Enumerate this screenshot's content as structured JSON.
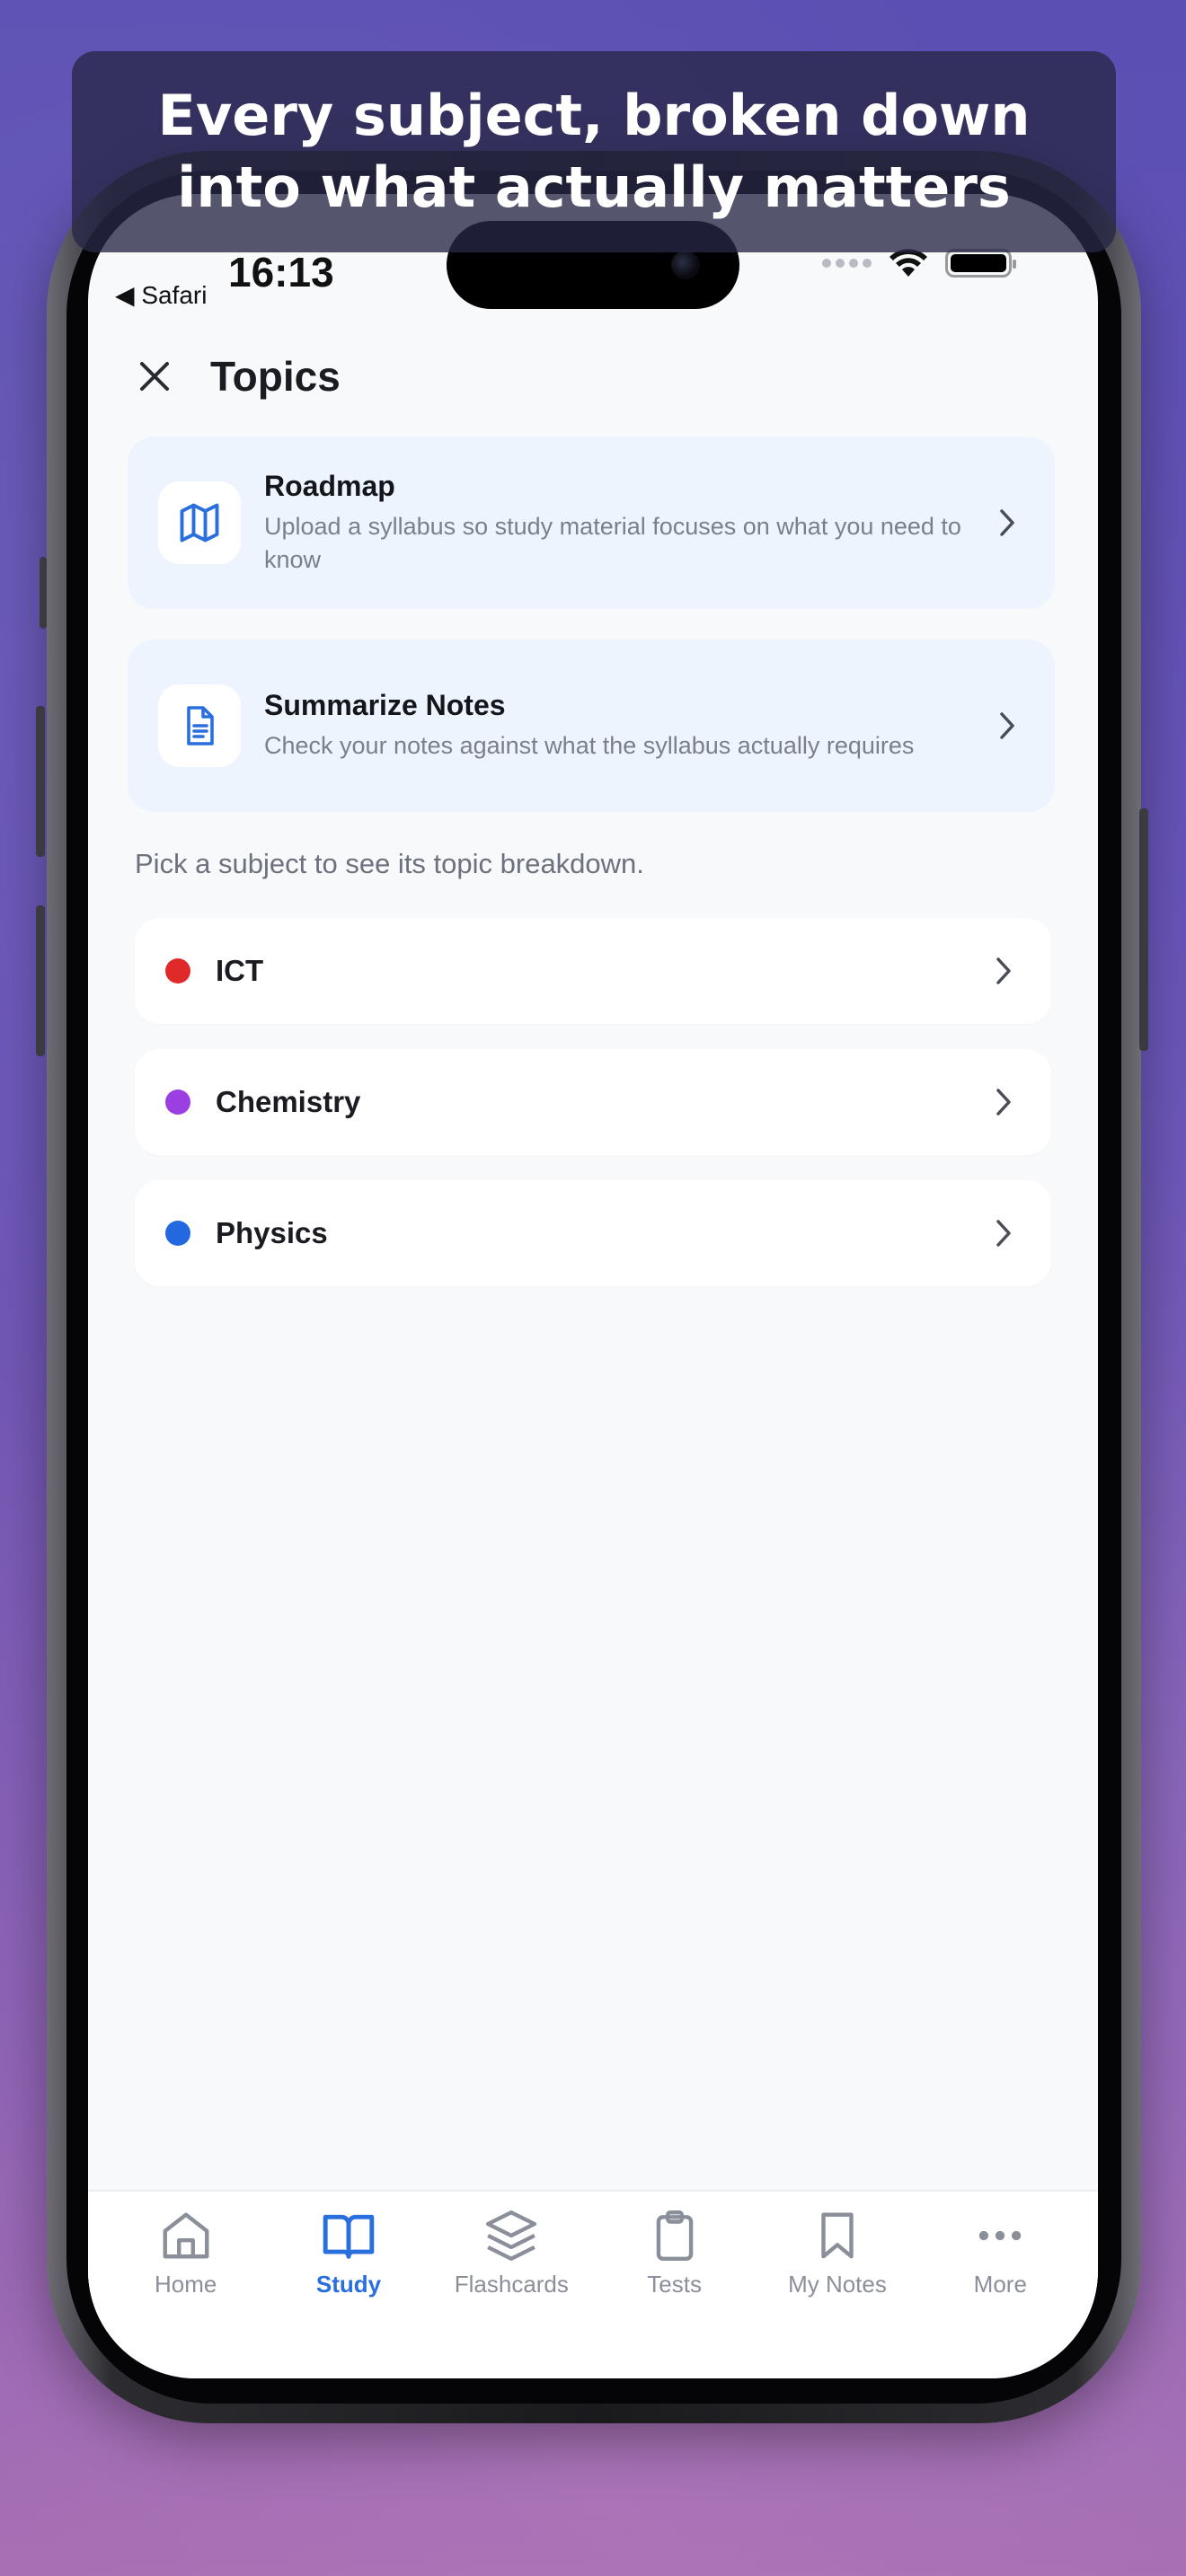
{
  "banner": {
    "headline": "Every subject, broken down into what actually matters"
  },
  "status_bar": {
    "time": "16:13",
    "back_label": "◀ Safari"
  },
  "header": {
    "title": "Topics"
  },
  "cards": [
    {
      "title": "Roadmap",
      "description": "Upload a syllabus so study material focuses on what you need to know",
      "icon": "map-icon"
    },
    {
      "title": "Summarize Notes",
      "description": "Check your notes against what the syllabus actually requires",
      "icon": "document-icon"
    }
  ],
  "hint": "Pick a subject to see its topic breakdown.",
  "subjects": [
    {
      "name": "ICT",
      "color": "#e02929"
    },
    {
      "name": "Chemistry",
      "color": "#9b3fe3"
    },
    {
      "name": "Physics",
      "color": "#2468e0"
    }
  ],
  "tabbar": {
    "tabs": [
      {
        "label": "Home",
        "icon": "home-icon",
        "active": false
      },
      {
        "label": "Study",
        "icon": "book-icon",
        "active": true
      },
      {
        "label": "Flashcards",
        "icon": "layers-icon",
        "active": false
      },
      {
        "label": "Tests",
        "icon": "clipboard-icon",
        "active": false
      },
      {
        "label": "My Notes",
        "icon": "bookmark-icon",
        "active": false
      },
      {
        "label": "More",
        "icon": "more-icon",
        "active": false
      }
    ]
  },
  "colors": {
    "accent": "#2a6fde",
    "card_bg": "#eef4fd",
    "screen_bg": "#f8f9fb"
  }
}
